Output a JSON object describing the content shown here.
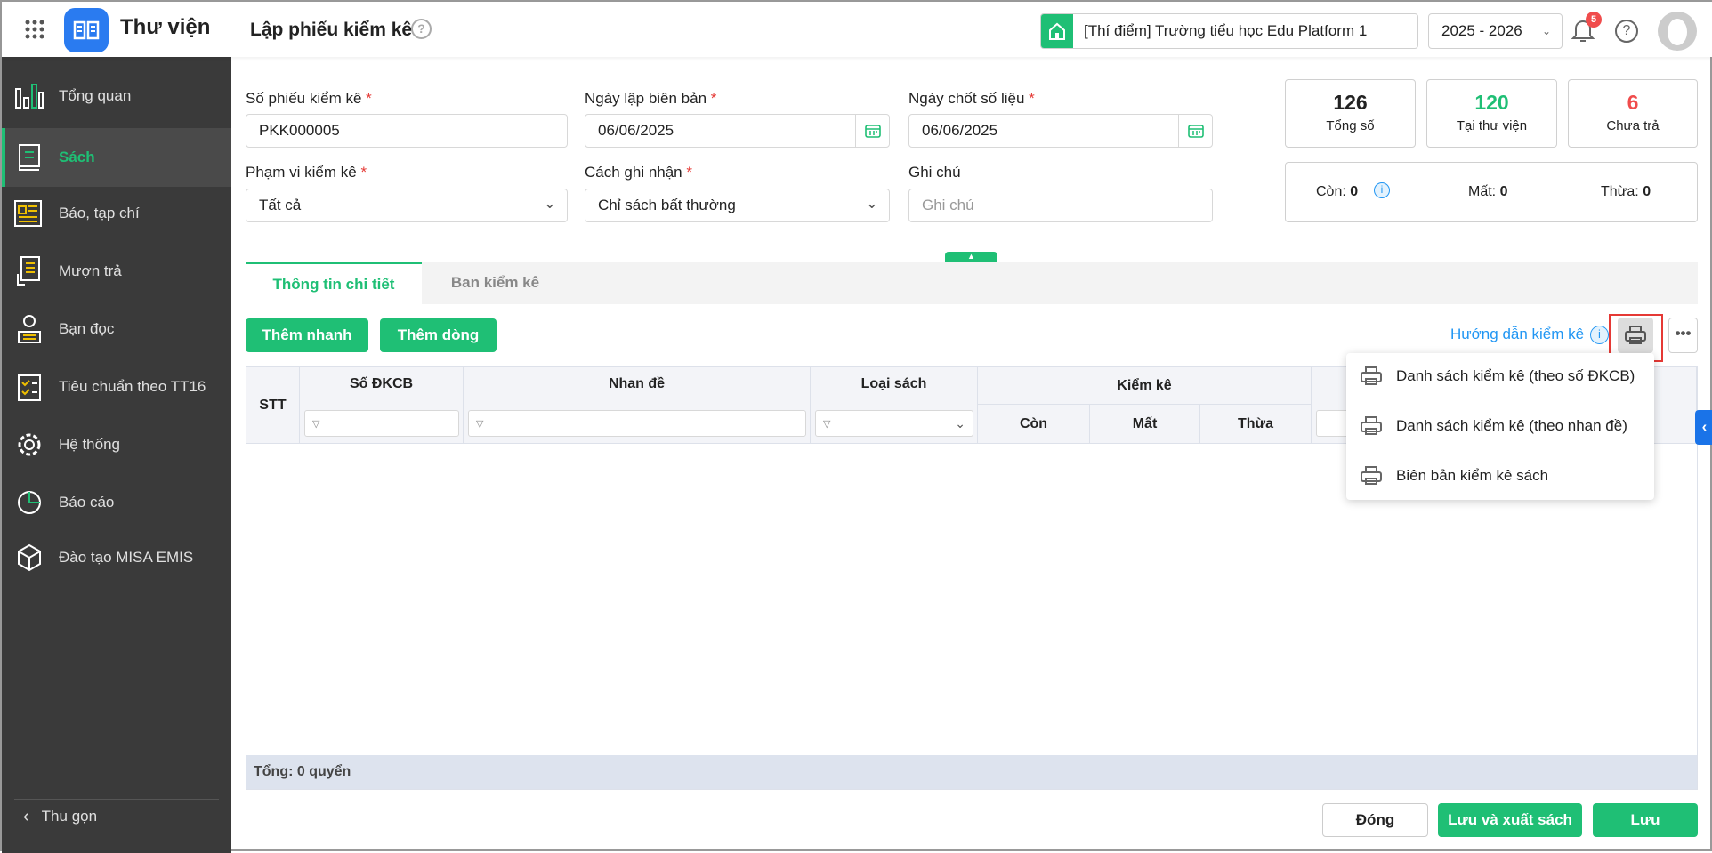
{
  "header": {
    "app_name": "Thư viện",
    "page_title": "Lập phiếu kiểm kê",
    "school": "[Thí điểm] Trường tiểu học Edu Platform 1",
    "year": "2025 - 2026",
    "notification_count": "5"
  },
  "sidebar": {
    "items": [
      {
        "label": "Tổng quan"
      },
      {
        "label": "Sách"
      },
      {
        "label": "Báo, tạp chí"
      },
      {
        "label": "Mượn trả"
      },
      {
        "label": "Bạn đọc"
      },
      {
        "label": "Tiêu chuẩn theo TT16"
      },
      {
        "label": "Hệ thống"
      },
      {
        "label": "Báo cáo"
      },
      {
        "label": "Đào tạo MISA EMIS"
      }
    ],
    "collapse": "Thu gọn"
  },
  "form": {
    "so_phieu": {
      "label": "Số phiếu kiểm kê",
      "value": "PKK000005"
    },
    "ngay_lap": {
      "label": "Ngày lập biên bản",
      "value": "06/06/2025"
    },
    "ngay_chot": {
      "label": "Ngày chốt số liệu",
      "value": "06/06/2025"
    },
    "pham_vi": {
      "label": "Phạm vi kiểm kê",
      "value": "Tất cả"
    },
    "cach_ghi": {
      "label": "Cách ghi nhận",
      "value": "Chỉ sách bất thường"
    },
    "ghi_chu": {
      "label": "Ghi chú",
      "placeholder": "Ghi chú"
    },
    "required": "*"
  },
  "stats": {
    "total": {
      "value": "126",
      "label": "Tổng số"
    },
    "in_library": {
      "value": "120",
      "label": "Tại thư viện"
    },
    "not_returned": {
      "value": "6",
      "label": "Chưa trả"
    },
    "con": {
      "label": "Còn:",
      "value": "0"
    },
    "mat": {
      "label": "Mất:",
      "value": "0"
    },
    "thua": {
      "label": "Thừa:",
      "value": "0"
    }
  },
  "tabs": [
    {
      "label": "Thông tin chi tiết"
    },
    {
      "label": "Ban kiểm kê"
    }
  ],
  "toolbar": {
    "quick_add": "Thêm nhanh",
    "add_row": "Thêm dòng",
    "guide": "Hướng dẫn kiểm kê"
  },
  "table": {
    "stt": "STT",
    "so_dkcb": "Số ĐKCB",
    "nhan_de": "Nhan đề",
    "loai_sach": "Loại sách",
    "kiem_ke": "Kiểm kê",
    "con": "Còn",
    "mat": "Mất",
    "thua": "Thừa",
    "footer": "Tổng: 0 quyển"
  },
  "print_menu": [
    {
      "label": "Danh sách kiểm kê (theo số ĐKCB)"
    },
    {
      "label": "Danh sách kiểm kê (theo nhan đề)"
    },
    {
      "label": "Biên bản kiểm kê sách"
    }
  ],
  "footer": {
    "close": "Đóng",
    "save_export": "Lưu và xuất sách",
    "save": "Lưu"
  },
  "colors": {
    "accent": "#1fbf75",
    "danger": "#f04c4c",
    "link": "#2196f3"
  }
}
